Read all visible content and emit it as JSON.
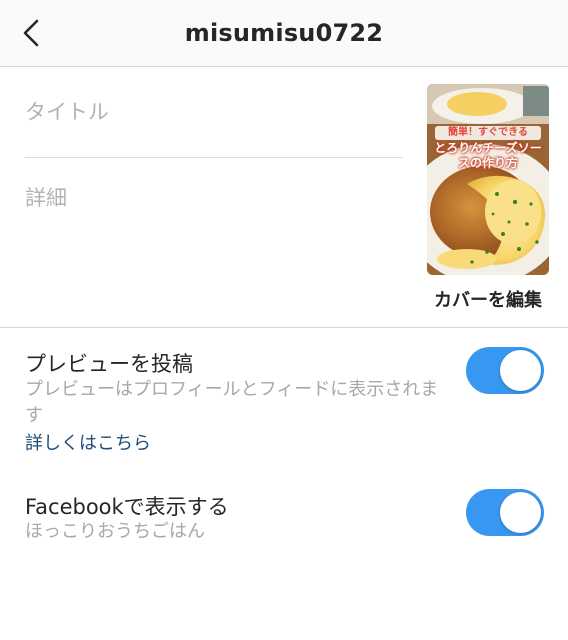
{
  "header": {
    "title": "misumisu0722",
    "back_icon": "chevron-left-icon"
  },
  "form": {
    "title_placeholder": "タイトル",
    "title_value": "",
    "detail_placeholder": "詳細",
    "detail_value": ""
  },
  "cover": {
    "caption_top": "簡単！すぐできる",
    "caption_main": "とろりんチーズソースの作り方",
    "edit_label": "カバーを編集"
  },
  "preview": {
    "title": "プレビューを投稿",
    "description": "プレビューはプロフィールとフィードに表示されます",
    "link": "詳しくはこちら",
    "enabled": true
  },
  "facebook": {
    "title": "Facebookで表示する",
    "page_name": "ほっこりおうちごはん",
    "enabled": true
  },
  "colors": {
    "toggle_on": "#3897f0",
    "link": "#1f4e78",
    "secondary_text": "#a8a8a8"
  }
}
